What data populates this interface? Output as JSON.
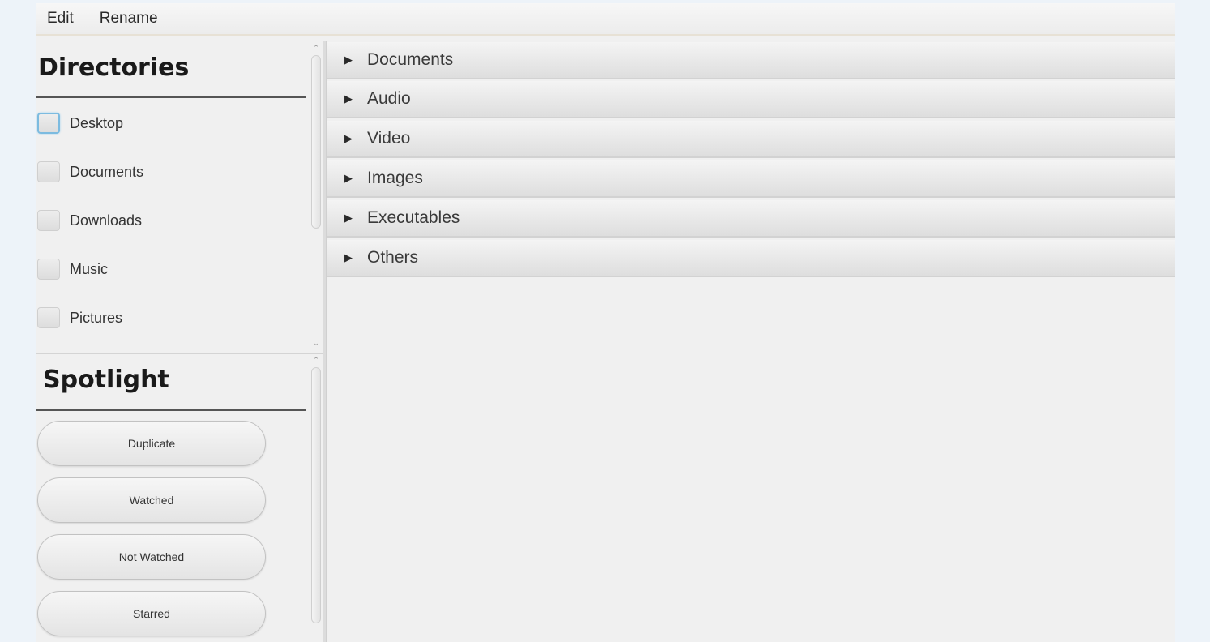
{
  "menu": {
    "items": [
      "Edit",
      "Rename"
    ]
  },
  "directories": {
    "title": "Directories",
    "items": [
      {
        "label": "Desktop",
        "checked": false,
        "focused": true
      },
      {
        "label": "Documents",
        "checked": false
      },
      {
        "label": "Downloads",
        "checked": false
      },
      {
        "label": "Music",
        "checked": false
      },
      {
        "label": "Pictures",
        "checked": false
      }
    ]
  },
  "spotlight": {
    "title": "Spotlight",
    "buttons": [
      "Duplicate",
      "Watched",
      "Not Watched",
      "Starred"
    ]
  },
  "categories": {
    "items": [
      "Documents",
      "Audio",
      "Video",
      "Images",
      "Executables",
      "Others"
    ]
  },
  "colors": {
    "background": "#edf3f9",
    "panel": "#f0f0f0",
    "focus": "#7cbbe0"
  }
}
